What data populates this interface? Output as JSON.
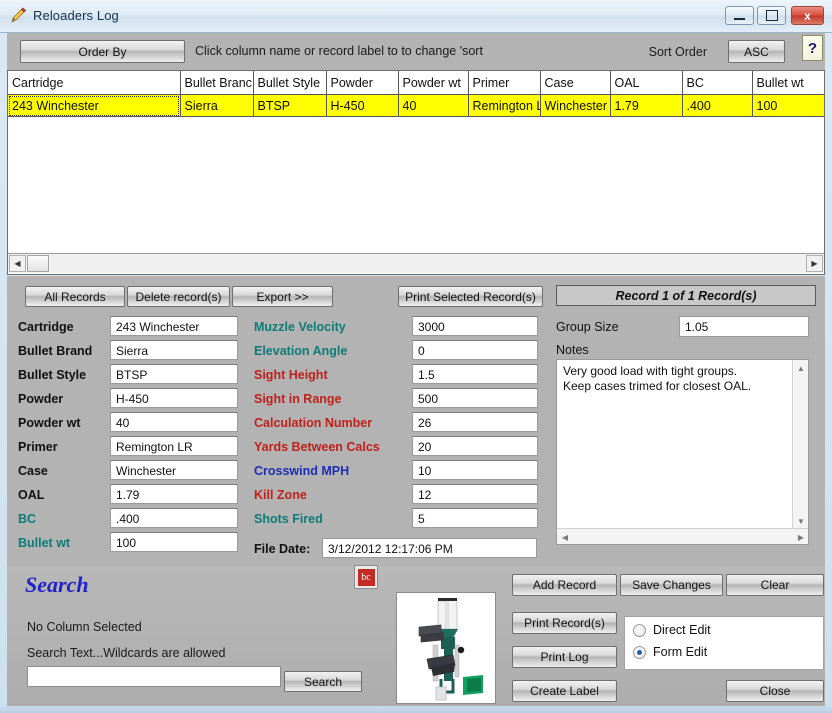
{
  "window": {
    "title": "Reloaders Log",
    "icon": "pencil-icon",
    "minimize_label": "minimize",
    "maximize_label": "maximize",
    "close_label": "x"
  },
  "toolbar": {
    "order_by_label": "Order By",
    "hint": "Click column name or record label to to change 'sort",
    "sort_order_label": "Sort Order",
    "asc_label": "ASC",
    "help_label": "?"
  },
  "grid": {
    "columns": [
      "Cartridge",
      "Bullet Branc",
      "Bullet Style",
      "Powder",
      "Powder wt",
      "Primer",
      "Case",
      "OAL",
      "BC",
      "Bullet wt"
    ],
    "rows": [
      [
        "243 Winchester",
        "Sierra",
        "BTSP",
        "H-450",
        "40",
        "Remington L",
        "Winchester",
        "1.79",
        ".400",
        "100"
      ]
    ],
    "row_highlight_color": "#ffff00"
  },
  "actions": {
    "all_records": "All Records",
    "delete_records": "Delete record(s)",
    "export": "Export >>",
    "print_selected": "Print Selected Record(s)",
    "record_counter": "Record 1 of 1 Record(s)"
  },
  "form": {
    "left_fields": [
      {
        "label": "Cartridge",
        "value": "243 Winchester",
        "color": "black"
      },
      {
        "label": "Bullet Brand",
        "value": "Sierra",
        "color": "black"
      },
      {
        "label": "Bullet Style",
        "value": "BTSP",
        "color": "black"
      },
      {
        "label": "Powder",
        "value": "H-450",
        "color": "black"
      },
      {
        "label": "Powder wt",
        "value": "40",
        "color": "black"
      },
      {
        "label": "Primer",
        "value": "Remington LR",
        "color": "black"
      },
      {
        "label": "Case",
        "value": "Winchester",
        "color": "black"
      },
      {
        "label": "OAL",
        "value": "1.79",
        "color": "black"
      },
      {
        "label": "BC",
        "value": ".400",
        "color": "teal"
      },
      {
        "label": "Bullet wt",
        "value": "100",
        "color": "teal"
      }
    ],
    "right_fields": [
      {
        "label": "Muzzle Velocity",
        "value": "3000",
        "color": "teal"
      },
      {
        "label": "Elevation Angle",
        "value": "0",
        "color": "teal"
      },
      {
        "label": "Sight Height",
        "value": "1.5",
        "color": "red"
      },
      {
        "label": "Sight in Range",
        "value": "500",
        "color": "red"
      },
      {
        "label": "Calculation Number",
        "value": "26",
        "color": "red"
      },
      {
        "label": "Yards Between Calcs",
        "value": "20",
        "color": "red"
      },
      {
        "label": "Crosswind MPH",
        "value": "10",
        "color": "blue"
      },
      {
        "label": "Kill Zone",
        "value": "12",
        "color": "red"
      },
      {
        "label": "Shots Fired",
        "value": "5",
        "color": "teal"
      }
    ],
    "file_date_label": "File Date:",
    "file_date_value": "3/12/2012 12:17:06 PM"
  },
  "details": {
    "group_size_label": "Group Size",
    "group_size_value": "1.05",
    "notes_label": "Notes",
    "notes_value": "Very good load with tight groups.\nKeep cases trimed for closest OAL."
  },
  "search": {
    "title": "Search",
    "column_status": "No Column Selected",
    "hint": "Search Text...Wildcards are allowed",
    "input_value": "",
    "button_label": "Search",
    "barcode_icon_label": "bc"
  },
  "buttons": {
    "add_record": "Add Record",
    "save_changes": "Save Changes",
    "clear": "Clear",
    "print_records": "Print Record(s)",
    "print_log": "Print Log",
    "create_label": "Create Label",
    "close": "Close"
  },
  "edit_mode": {
    "options": [
      {
        "label": "Direct Edit",
        "selected": false
      },
      {
        "label": "Form Edit",
        "selected": true
      }
    ]
  },
  "colors": {
    "teal": "#0d7b77",
    "red": "#c0201b",
    "blue": "#1c2eb4",
    "highlight_row": "#ffff00",
    "search_title": "#2222c9",
    "panel_gray": "#b3b3b3"
  }
}
